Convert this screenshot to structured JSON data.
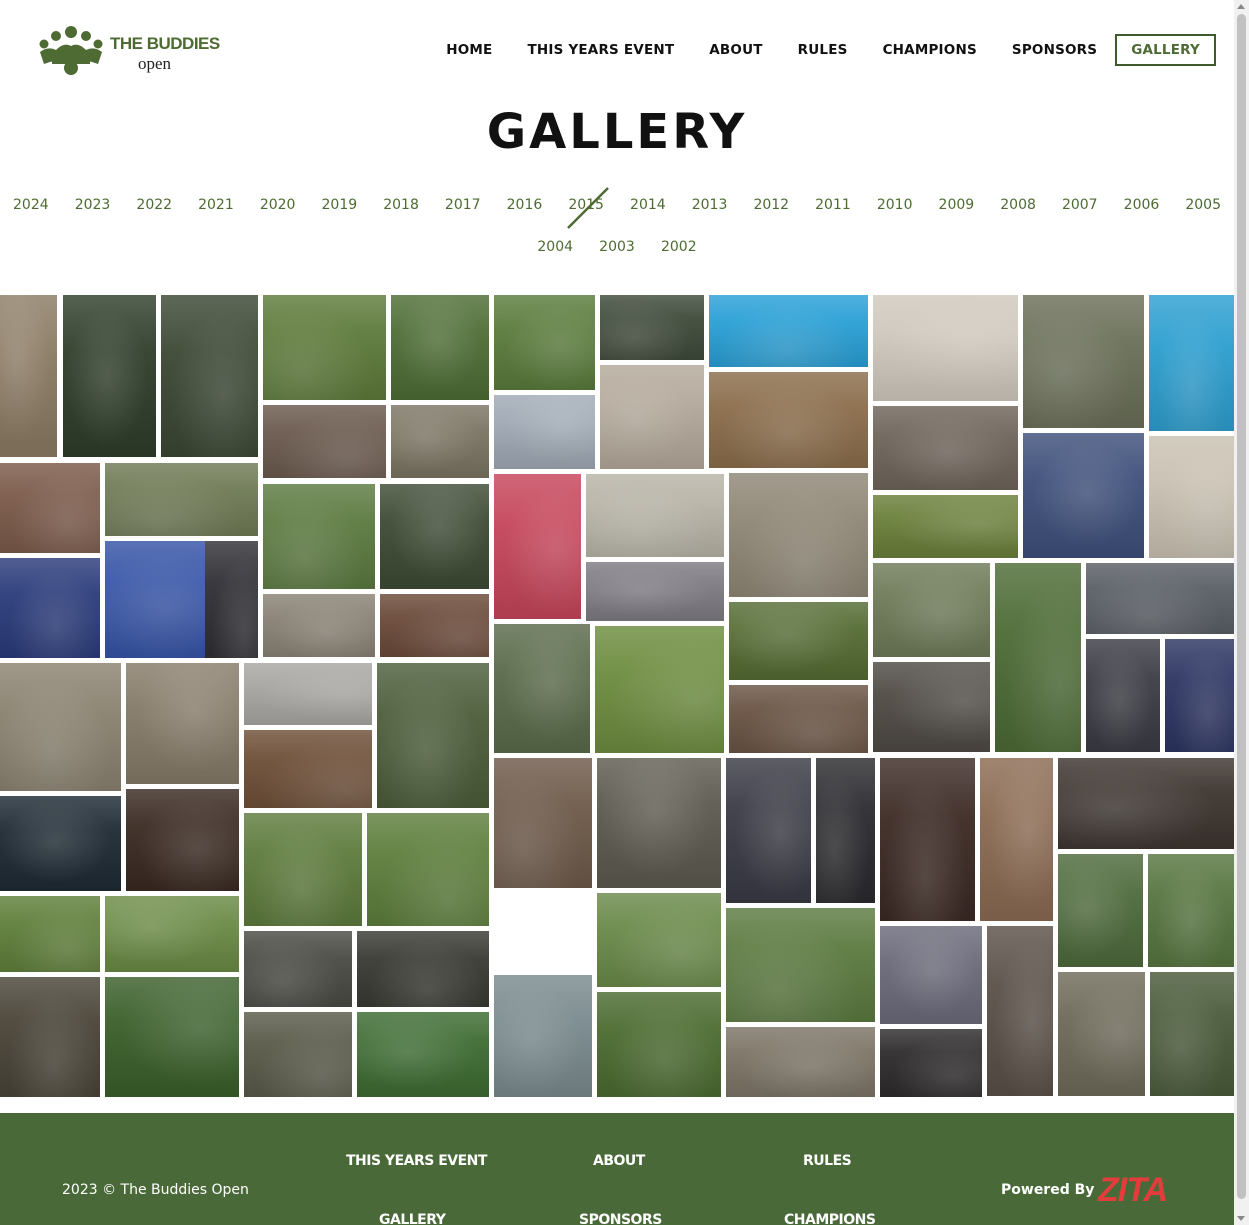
{
  "site": {
    "logo_name": "THE BUDDIES",
    "logo_sub": "open"
  },
  "nav": [
    {
      "label": "HOME"
    },
    {
      "label": "THIS YEARS EVENT"
    },
    {
      "label": "ABOUT"
    },
    {
      "label": "RULES"
    },
    {
      "label": "CHAMPIONS"
    },
    {
      "label": "SPONSORS"
    },
    {
      "label": "GALLERY",
      "active": true
    }
  ],
  "page_title": "GALLERY",
  "years": [
    "2024",
    "2023",
    "2022",
    "2021",
    "2020",
    "2019",
    "2018",
    "2017",
    "2016",
    "2015",
    "2014",
    "2013",
    "2012",
    "2011",
    "2010",
    "2009",
    "2008",
    "2007",
    "2006",
    "2005",
    "2004",
    "2003",
    "2002"
  ],
  "footer": {
    "copyright": "2023 © The Buddies Open",
    "links": [
      "THIS YEARS EVENT",
      "ABOUT",
      "RULES",
      "GALLERY",
      "SPONSORS",
      "CHAMPIONS"
    ],
    "powered_by": "Powered By",
    "powered_brand": "ZITA"
  },
  "colors": {
    "brand_green": "#4d6b32",
    "footer_green": "#496a38",
    "zita_red": "#e23c3c"
  }
}
